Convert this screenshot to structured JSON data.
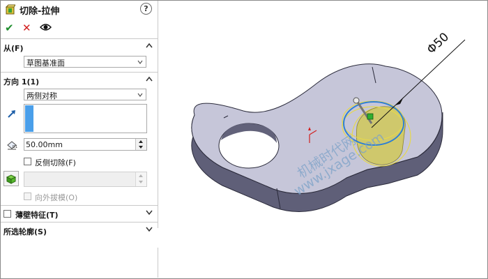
{
  "feature": {
    "title": "切除-拉伸",
    "help_glyph": "?"
  },
  "toolbar": {
    "ok_glyph": "✔",
    "cancel_glyph": "✕"
  },
  "from": {
    "label": "从(F)",
    "selected": "草图基准面"
  },
  "direction1": {
    "label": "方向 1(1)",
    "end_condition": "两侧对称",
    "depth_value": "50.00mm",
    "flip_side_label": "反侧切除(F)",
    "draft_outward_label": "向外拔模(O)"
  },
  "thin_feature": {
    "label": "薄壁特征(T)"
  },
  "selected_contours": {
    "label": "所选轮廓(S)"
  },
  "viewport": {
    "dimension_label": "Φ50",
    "watermark_line1": "机械时代网",
    "watermark_line2": "www.jxage.com"
  },
  "colors": {
    "part_face": "#c6c6d9",
    "part_side": "#5f5f78",
    "selection_blue": "#2f7fd6",
    "preview_yellow": "#e6d84a",
    "watermark": "#7da2c8"
  }
}
